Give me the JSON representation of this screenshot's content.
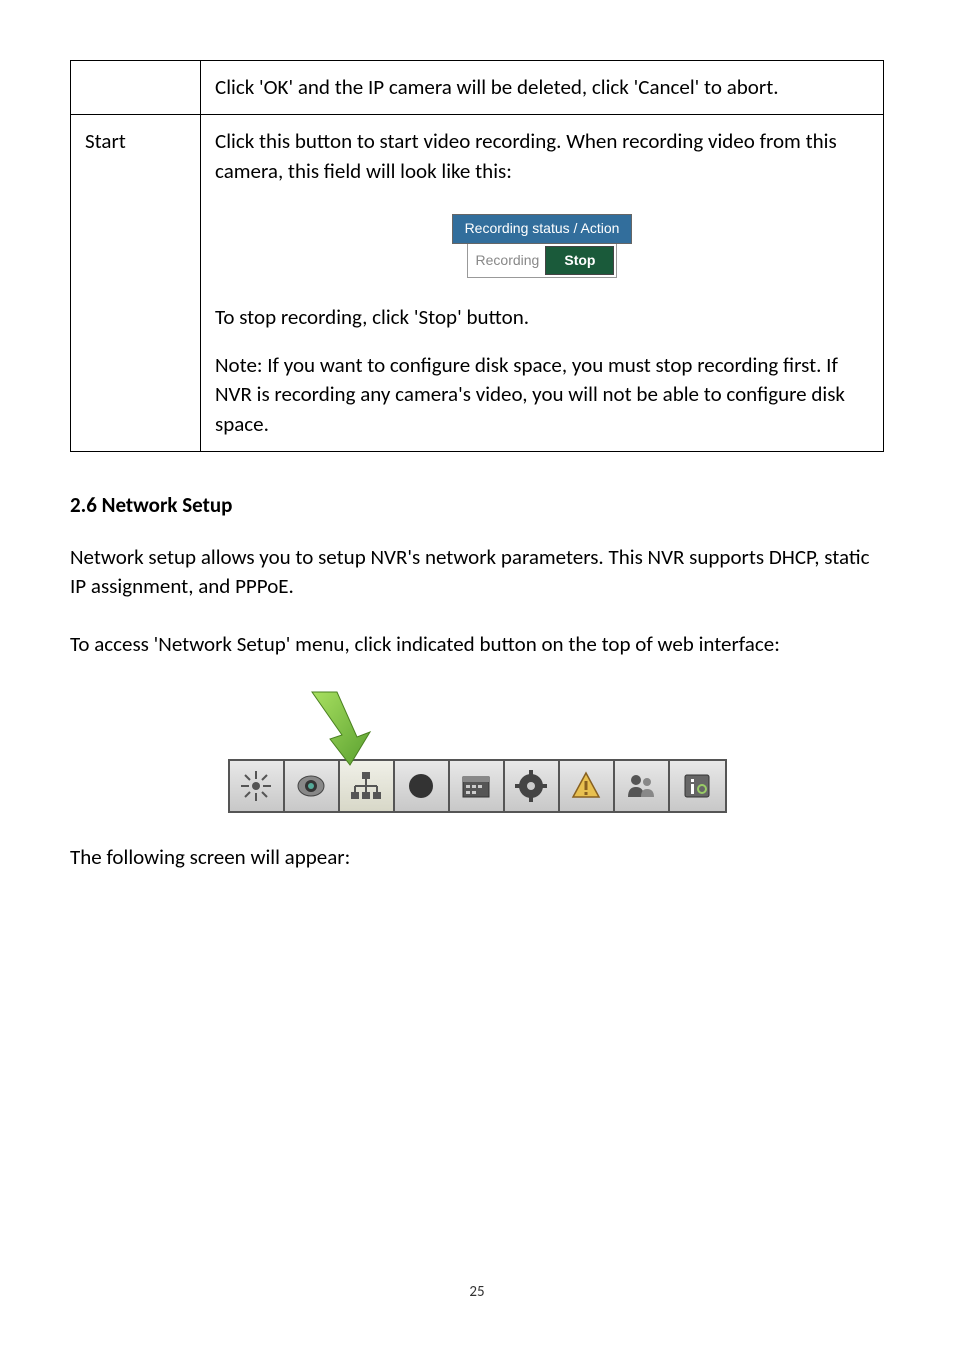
{
  "table": {
    "row1": {
      "left": "",
      "right": "Click 'OK' and the IP camera will be deleted, click 'Cancel' to abort."
    },
    "row2": {
      "left": "Start",
      "right_p1": "Click this button to start video recording. When recording video from this camera, this field will look like this:",
      "recording_header": "Recording status / Action",
      "recording_label": "Recording",
      "stop_label": "Stop",
      "right_p2": "To stop recording, click 'Stop' button.",
      "right_p3": "Note: If you want to configure disk space, you must stop recording first. If NVR is recording any camera's video, you will not be able to configure disk space."
    }
  },
  "section_heading": "2.6 Network Setup",
  "body_p1": "Network setup allows you to setup NVR's network parameters. This NVR supports DHCP, static IP assignment, and PPPoE.",
  "body_p2": "To access 'Network Setup' menu, click indicated button on the top of web interface:",
  "body_p3": "The following screen will appear:",
  "toolbar_icons": {
    "i0": "spark-icon",
    "i1": "camera-icon",
    "i2": "network-icon",
    "i3": "record-icon",
    "i4": "schedule-icon",
    "i5": "gear-icon",
    "i6": "alert-icon",
    "i7": "user-icon",
    "i8": "info-icon"
  },
  "page_number": "25"
}
